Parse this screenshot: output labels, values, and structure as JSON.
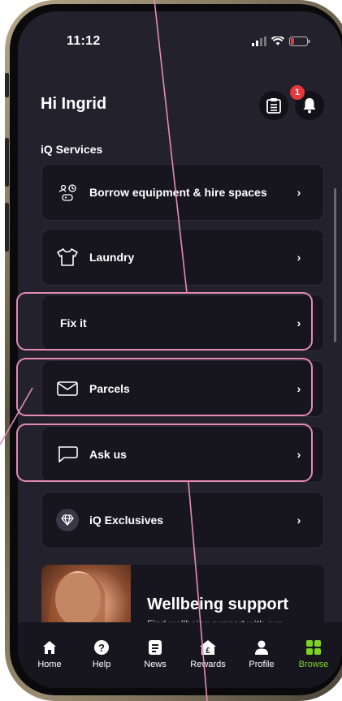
{
  "status_bar": {
    "time": "11:12"
  },
  "header": {
    "greeting": "Hi Ingrid",
    "notification_badge": "1"
  },
  "services": {
    "title": "iQ Services",
    "items": [
      {
        "label": "Borrow equipment & hire spaces",
        "icon": "equipment-icon"
      },
      {
        "label": "Laundry",
        "icon": "tshirt-icon"
      },
      {
        "label": "Fix it",
        "icon": ""
      },
      {
        "label": "Parcels",
        "icon": "envelope-icon"
      },
      {
        "label": "Ask us",
        "icon": "chat-bubble-icon"
      },
      {
        "label": "iQ Exclusives",
        "icon": "diamond-icon"
      }
    ],
    "chevron": "›"
  },
  "wellbeing": {
    "title": "Wellbeing support",
    "subtitle": "Find wellbeing support with our"
  },
  "tabs": [
    {
      "label": "Home",
      "icon": "home-icon"
    },
    {
      "label": "Help",
      "icon": "help-icon"
    },
    {
      "label": "News",
      "icon": "news-icon"
    },
    {
      "label": "Rewards",
      "icon": "rewards-icon"
    },
    {
      "label": "Profile",
      "icon": "profile-icon"
    },
    {
      "label": "Browse",
      "icon": "browse-icon",
      "active": true
    }
  ],
  "colors": {
    "background": "#23212c",
    "card": "#17161e",
    "accent": "#7ed321",
    "badge": "#e5383b",
    "highlight": "#e48bb8"
  }
}
